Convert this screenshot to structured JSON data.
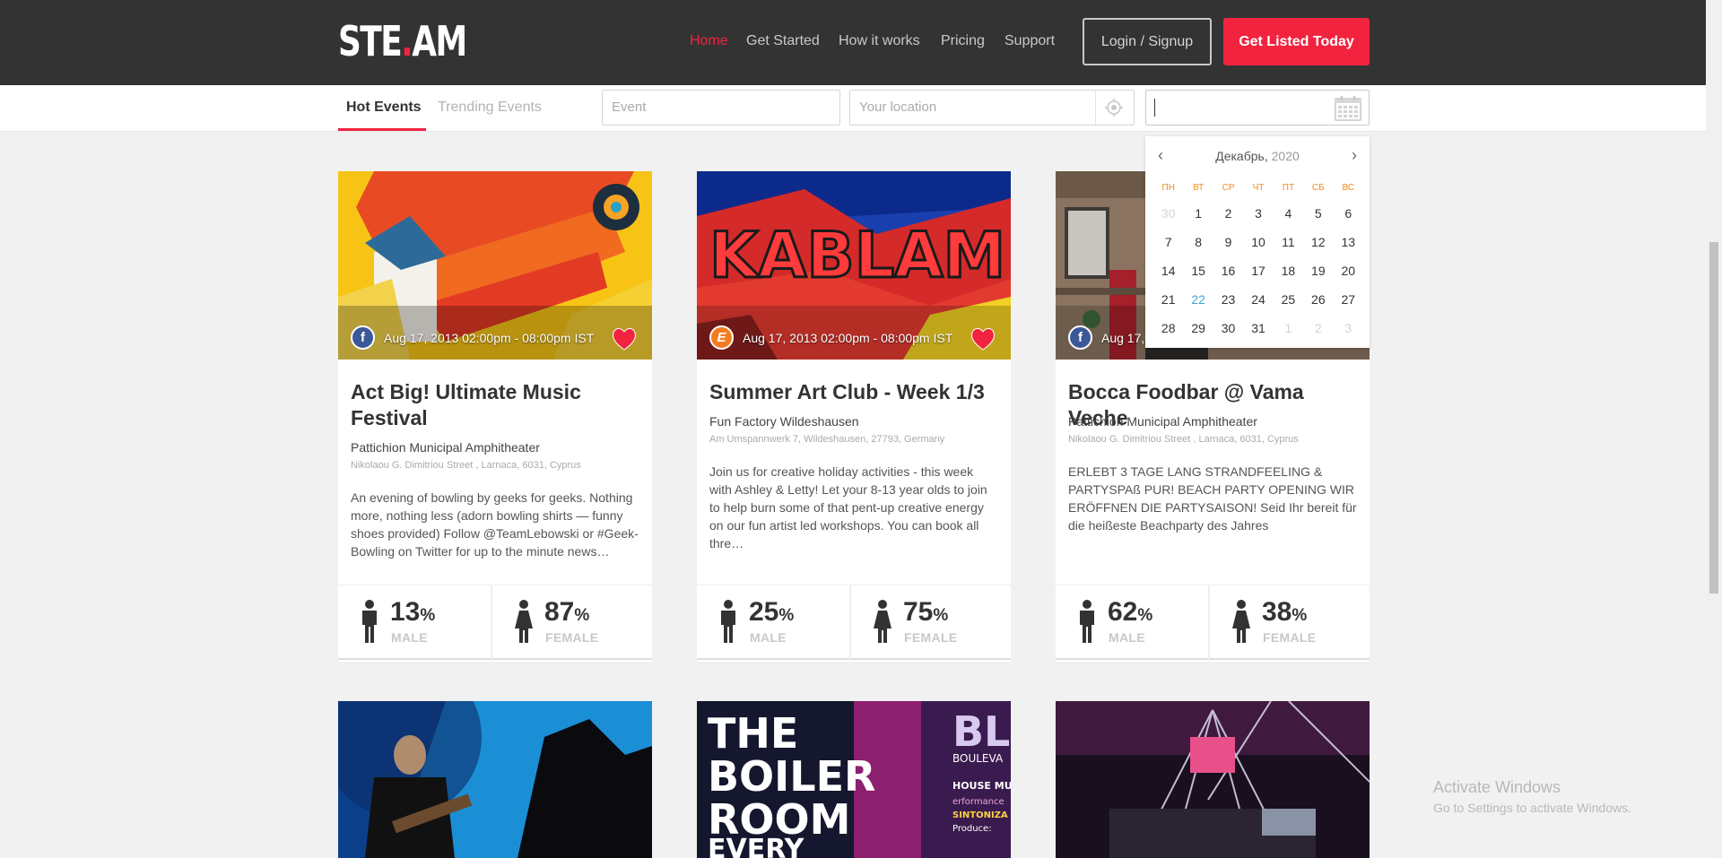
{
  "header": {
    "logo_main": "STE",
    "logo_dot": ".",
    "logo_end": "AM",
    "nav": [
      "Home",
      "Get Started",
      "How it works",
      "Pricing",
      "Support"
    ],
    "login_label": "Login / Signup",
    "listed_label": "Get Listed Today"
  },
  "filters": {
    "tabs": [
      "Hot Events",
      "Trending Events"
    ],
    "event_placeholder": "Event",
    "location_placeholder": "Your location"
  },
  "calendar": {
    "month": "Декабрь,",
    "year": "2020",
    "weekdays": [
      "ПН",
      "ВТ",
      "СР",
      "ЧТ",
      "ПТ",
      "СБ",
      "ВС"
    ],
    "weeks": [
      [
        "30",
        "1",
        "2",
        "3",
        "4",
        "5",
        "6"
      ],
      [
        "7",
        "8",
        "9",
        "10",
        "11",
        "12",
        "13"
      ],
      [
        "14",
        "15",
        "16",
        "17",
        "18",
        "19",
        "20"
      ],
      [
        "21",
        "22",
        "23",
        "24",
        "25",
        "26",
        "27"
      ],
      [
        "28",
        "29",
        "30",
        "31",
        "1",
        "2",
        "3"
      ]
    ],
    "today": "22"
  },
  "events": [
    {
      "date": "Aug 17, 2013 02:00pm - 08:00pm IST",
      "title": "Act Big! Ultimate Music Festival",
      "venue": "Pattichion Municipal Amphitheater",
      "address": "Nikolaou G. Dimitriou Street , Larnaca, 6031, Cyprus",
      "description": "An evening of bowling by geeks for geeks. Nothing more, nothing less (adorn bowling shirts — funny shoes provided) Follow @TeamLebowski or #Geek-Bowling on Twitter for up to the minute news…",
      "male": "13",
      "female": "87"
    },
    {
      "date": "Aug 17, 2013 02:00pm - 08:00pm IST",
      "title": "Summer Art Club - Week 1/3",
      "venue": "Fun Factory Wildeshausen",
      "address": "Am Umspannwerk 7, Wildeshausen, 27793, Germany",
      "description": "Join us for creative holiday activities - this week with Ashley & Letty! Let your 8-13 year olds to join to help burn some of that pent-up creative energy on our fun artist led workshops. You can book all thre…",
      "male": "25",
      "female": "75"
    },
    {
      "date": "Aug 17,",
      "title": "Bocca Foodbar @ Vama Veche",
      "venue": "Pattichion Municipal Amphitheater",
      "address": "Nikolaou G. Dimitriou Street , Larnaca, 6031, Cyprus",
      "description": "ERLEBT 3 TAGE LANG STRANDFEELING & PARTYSPAß PUR! BEACH PARTY OPENING WIR ERÖFFNEN DIE PARTYSAISON! Seid Ihr bereit für die heißeste Beachparty des Jahres",
      "male": "62",
      "female": "38"
    }
  ],
  "stat_labels": {
    "pct": "%",
    "male": "MALE",
    "female": "FEMALE"
  },
  "poster": {
    "line1": "THE",
    "line2": "BOILER",
    "line3": "ROOM",
    "line4": "EVERY",
    "side1": "BL",
    "side2": "BOULEVA",
    "side3": "HOUSE MU",
    "side4": "erformance",
    "side5": "SINTONIZA",
    "side6": "Produce:"
  },
  "kablam_text": "KABLAM",
  "watermark": {
    "line1": "Activate Windows",
    "line2": "Go to Settings to activate Windows."
  }
}
